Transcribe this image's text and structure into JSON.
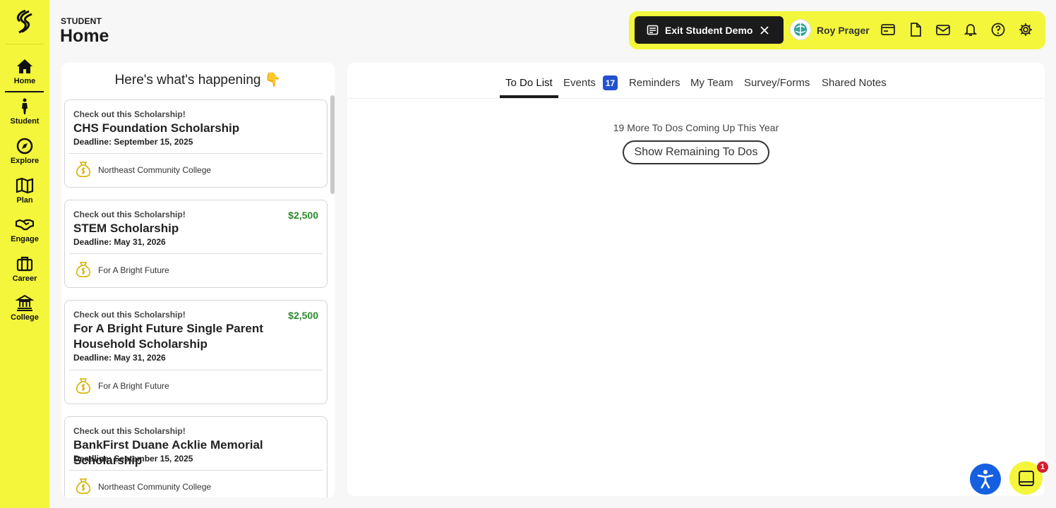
{
  "sidebar": {
    "logo_icon": "naviance-logo-icon",
    "items": [
      {
        "label": "Home",
        "icon": "home-icon"
      },
      {
        "label": "Student",
        "icon": "student-icon"
      },
      {
        "label": "Explore",
        "icon": "compass-icon"
      },
      {
        "label": "Plan",
        "icon": "map-icon"
      },
      {
        "label": "Engage",
        "icon": "handshake-icon"
      },
      {
        "label": "Career",
        "icon": "briefcase-icon"
      },
      {
        "label": "College",
        "icon": "institution-icon"
      }
    ],
    "active": "Home"
  },
  "header": {
    "kicker": "STUDENT",
    "title": "Home"
  },
  "topbar": {
    "exit_demo_label": "Exit Student Demo",
    "user_name": "Roy Prager",
    "icons": [
      "id-card-icon",
      "document-icon",
      "mail-icon",
      "bell-icon",
      "help-icon",
      "gear-icon"
    ]
  },
  "feed": {
    "heading": "Here's what's happening 👇",
    "cards": [
      {
        "kicker": "Check out this Scholarship!",
        "title": "CHS Foundation Scholarship",
        "amount": "",
        "deadline": "Deadline: September 15, 2025",
        "org": "Northeast Community College"
      },
      {
        "kicker": "Check out this Scholarship!",
        "title": "STEM Scholarship",
        "amount": "$2,500",
        "deadline": "Deadline: May 31, 2026",
        "org": "For A Bright Future"
      },
      {
        "kicker": "Check out this Scholarship!",
        "title": "For A Bright Future Single Parent Household Scholarship",
        "amount": "$2,500",
        "deadline": "Deadline: May 31, 2026",
        "org": "For A Bright Future"
      },
      {
        "kicker": "Check out this Scholarship!",
        "title": "BankFirst Duane Acklie Memorial Scholarship",
        "amount": "",
        "deadline": "Deadline: September 15, 2025",
        "org": "Northeast Community College"
      }
    ]
  },
  "tabs": {
    "items": [
      "To Do List",
      "Events",
      "Reminders",
      "My Team",
      "Survey/Forms",
      "Shared Notes"
    ],
    "active": "To Do List",
    "events_count": "17"
  },
  "todo": {
    "more_text": "19 More To Dos Coming Up This Year",
    "show_button": "Show Remaining To Dos"
  },
  "floating": {
    "chat_badge": "1"
  },
  "colors": {
    "brand_yellow": "#f3f63a",
    "amount_green": "#2e8a2e",
    "badge_blue": "#2251d1",
    "access_blue": "#1560e0"
  }
}
